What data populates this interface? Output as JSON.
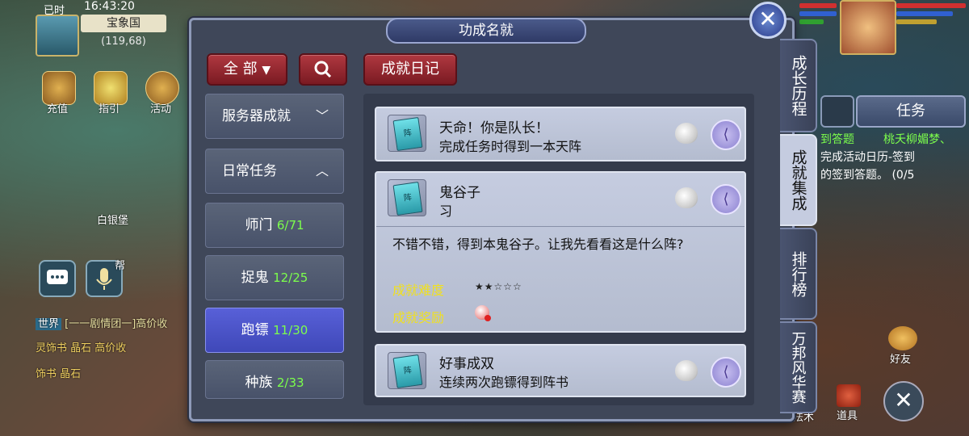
{
  "hud": {
    "time_prefix": "已时",
    "time": "16:43:20",
    "location": "宝象国",
    "coords": "(119,68)",
    "icons": [
      {
        "name": "recharge-icon",
        "label": "充值"
      },
      {
        "name": "guide-icon",
        "label": "指引"
      },
      {
        "name": "activity-icon",
        "label": "活动"
      }
    ],
    "map_label": "白银堡",
    "gang_label": "帮",
    "chat": [
      {
        "channel": "世界",
        "text": "[一一剧情团一]高价收"
      },
      {
        "channel": "",
        "text": "灵饰书 晶石   高价收"
      },
      {
        "channel": "",
        "text": "饰书 晶石"
      }
    ],
    "task_tab": "任务",
    "task_title": "到答题",
    "task_other": "桃夭柳媚梦、",
    "task_text1": "完成活动日历-签到",
    "task_text2": "的签到答题。 (0/5",
    "friend_label": "好友",
    "props_label": "道具",
    "magic_label": "法术"
  },
  "dialog": {
    "title": "功成名就",
    "close_icon": "close-icon",
    "filter_label": "全 部",
    "search_icon": "search-icon",
    "diary_label": "成就日记",
    "categories": [
      {
        "label": "服务器成就",
        "type": "header",
        "state": "collapsed"
      },
      {
        "label": "日常任务",
        "type": "header",
        "state": "expanded"
      },
      {
        "label": "师门",
        "count": "6/71"
      },
      {
        "label": "捉鬼",
        "count": "12/25"
      },
      {
        "label": "跑镖",
        "count": "11/30",
        "selected": true
      },
      {
        "label": "种族",
        "count": "2/33"
      }
    ],
    "cards": [
      {
        "title": "天命！你是队长！",
        "desc": "完成任务时得到一本天阵"
      },
      {
        "title": "鬼谷子",
        "desc": "习",
        "detail": "不错不错，得到本鬼谷子。让我先看看这是什么阵?",
        "difficulty_label": "成就难度",
        "difficulty_stars": "★★☆☆☆",
        "reward_label": "成就奖励"
      },
      {
        "title": "好事成双",
        "desc": "连续两次跑镖得到阵书"
      }
    ],
    "tabs": [
      {
        "label": "成长历程"
      },
      {
        "label": "成就集成",
        "active": true
      },
      {
        "label": "排行榜"
      },
      {
        "label": "万邦风华赛"
      }
    ]
  }
}
